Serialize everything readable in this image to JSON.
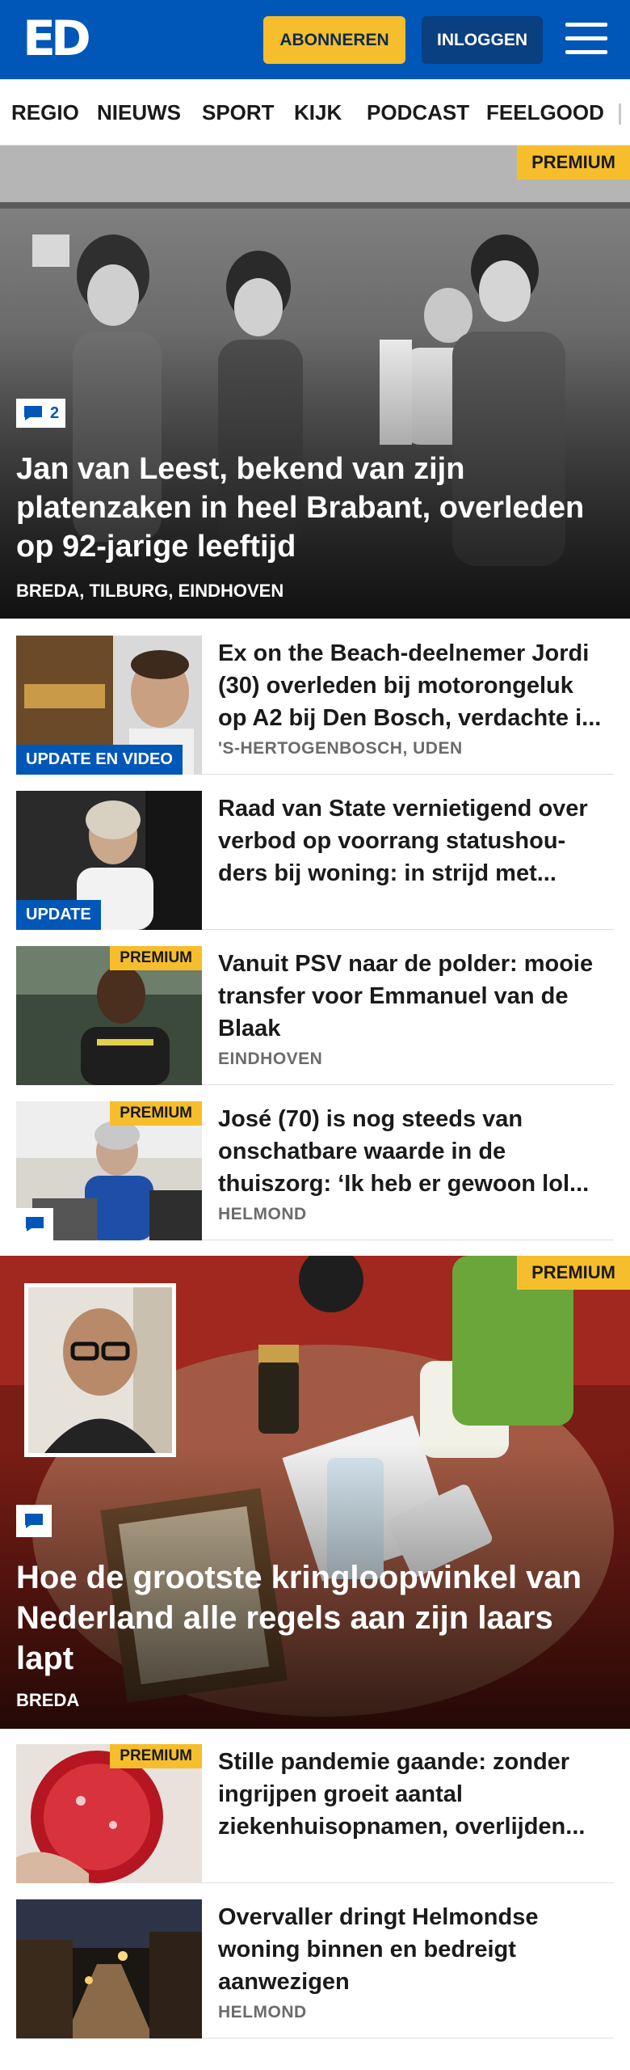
{
  "header": {
    "logo": "ED",
    "subscribe_label": "ABONNEREN",
    "login_label": "INLOGGEN",
    "menu_icon": "hamburger-menu-icon"
  },
  "nav": {
    "items": [
      "REGIO",
      "NIEUWS",
      "SPORT",
      "KIJK",
      "PODCAST",
      "FEELGOOD"
    ]
  },
  "hero": {
    "premium": "PREMIUM",
    "comments": "2",
    "title": "Jan van Leest, bekend van zijn platenzaken in heel Brabant, overleden op 92-jarige leeftijd",
    "location": "BREDA, TILBURG, EINDHOVEN"
  },
  "articles": [
    {
      "tag": "UPDATE EN VIDEO",
      "title": "Ex on the Beach-deelnemer Jordi (30) overleden bij motorongeluk op A2 bij Den Bosch, verdachte i...",
      "location": "'S-HERTOGENBOSCH, UDEN"
    },
    {
      "tag": "UPDATE",
      "title": "Raad van State vernietigend over verbod op voorrang statushou­ders bij woning: in strijd met..."
    },
    {
      "premium": "PREMIUM",
      "title": "Vanuit PSV naar de polder: mooie transfer voor Emmanuel van de Blaak",
      "location": "EINDHOVEN"
    },
    {
      "premium": "PREMIUM",
      "title": "José (70) is nog steeds van onschatbare waarde in de thuiszorg: ‘Ik heb er gewoon lol...",
      "location": "HELMOND"
    }
  ],
  "hero2": {
    "premium": "PREMIUM",
    "title": "Hoe de grootste kringloopwinkel van Nederland alle regels aan zijn laars lapt",
    "location": "BREDA"
  },
  "articles2": [
    {
      "premium": "PREMIUM",
      "title": "Stille pandemie gaande: zonder ingrijpen groeit aantal ziekenhuisopnamen, overlijden..."
    },
    {
      "title": "Overvaller dringt Helmondse woning binnen en bedreigt aanwezigen",
      "location": "HELMOND"
    }
  ],
  "colors": {
    "brand_blue": "#0057b8",
    "premium_yellow": "#f6be2c"
  }
}
